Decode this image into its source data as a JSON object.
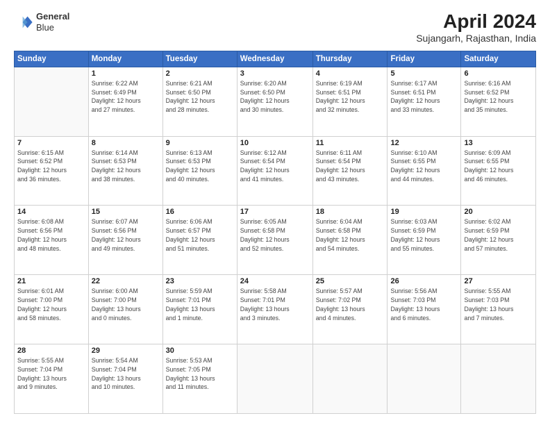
{
  "logo": {
    "line1": "General",
    "line2": "Blue"
  },
  "title": "April 2024",
  "subtitle": "Sujangarh, Rajasthan, India",
  "header": {
    "days": [
      "Sunday",
      "Monday",
      "Tuesday",
      "Wednesday",
      "Thursday",
      "Friday",
      "Saturday"
    ]
  },
  "weeks": [
    [
      {
        "day": "",
        "info": ""
      },
      {
        "day": "1",
        "info": "Sunrise: 6:22 AM\nSunset: 6:49 PM\nDaylight: 12 hours\nand 27 minutes."
      },
      {
        "day": "2",
        "info": "Sunrise: 6:21 AM\nSunset: 6:50 PM\nDaylight: 12 hours\nand 28 minutes."
      },
      {
        "day": "3",
        "info": "Sunrise: 6:20 AM\nSunset: 6:50 PM\nDaylight: 12 hours\nand 30 minutes."
      },
      {
        "day": "4",
        "info": "Sunrise: 6:19 AM\nSunset: 6:51 PM\nDaylight: 12 hours\nand 32 minutes."
      },
      {
        "day": "5",
        "info": "Sunrise: 6:17 AM\nSunset: 6:51 PM\nDaylight: 12 hours\nand 33 minutes."
      },
      {
        "day": "6",
        "info": "Sunrise: 6:16 AM\nSunset: 6:52 PM\nDaylight: 12 hours\nand 35 minutes."
      }
    ],
    [
      {
        "day": "7",
        "info": "Sunrise: 6:15 AM\nSunset: 6:52 PM\nDaylight: 12 hours\nand 36 minutes."
      },
      {
        "day": "8",
        "info": "Sunrise: 6:14 AM\nSunset: 6:53 PM\nDaylight: 12 hours\nand 38 minutes."
      },
      {
        "day": "9",
        "info": "Sunrise: 6:13 AM\nSunset: 6:53 PM\nDaylight: 12 hours\nand 40 minutes."
      },
      {
        "day": "10",
        "info": "Sunrise: 6:12 AM\nSunset: 6:54 PM\nDaylight: 12 hours\nand 41 minutes."
      },
      {
        "day": "11",
        "info": "Sunrise: 6:11 AM\nSunset: 6:54 PM\nDaylight: 12 hours\nand 43 minutes."
      },
      {
        "day": "12",
        "info": "Sunrise: 6:10 AM\nSunset: 6:55 PM\nDaylight: 12 hours\nand 44 minutes."
      },
      {
        "day": "13",
        "info": "Sunrise: 6:09 AM\nSunset: 6:55 PM\nDaylight: 12 hours\nand 46 minutes."
      }
    ],
    [
      {
        "day": "14",
        "info": "Sunrise: 6:08 AM\nSunset: 6:56 PM\nDaylight: 12 hours\nand 48 minutes."
      },
      {
        "day": "15",
        "info": "Sunrise: 6:07 AM\nSunset: 6:56 PM\nDaylight: 12 hours\nand 49 minutes."
      },
      {
        "day": "16",
        "info": "Sunrise: 6:06 AM\nSunset: 6:57 PM\nDaylight: 12 hours\nand 51 minutes."
      },
      {
        "day": "17",
        "info": "Sunrise: 6:05 AM\nSunset: 6:58 PM\nDaylight: 12 hours\nand 52 minutes."
      },
      {
        "day": "18",
        "info": "Sunrise: 6:04 AM\nSunset: 6:58 PM\nDaylight: 12 hours\nand 54 minutes."
      },
      {
        "day": "19",
        "info": "Sunrise: 6:03 AM\nSunset: 6:59 PM\nDaylight: 12 hours\nand 55 minutes."
      },
      {
        "day": "20",
        "info": "Sunrise: 6:02 AM\nSunset: 6:59 PM\nDaylight: 12 hours\nand 57 minutes."
      }
    ],
    [
      {
        "day": "21",
        "info": "Sunrise: 6:01 AM\nSunset: 7:00 PM\nDaylight: 12 hours\nand 58 minutes."
      },
      {
        "day": "22",
        "info": "Sunrise: 6:00 AM\nSunset: 7:00 PM\nDaylight: 13 hours\nand 0 minutes."
      },
      {
        "day": "23",
        "info": "Sunrise: 5:59 AM\nSunset: 7:01 PM\nDaylight: 13 hours\nand 1 minute."
      },
      {
        "day": "24",
        "info": "Sunrise: 5:58 AM\nSunset: 7:01 PM\nDaylight: 13 hours\nand 3 minutes."
      },
      {
        "day": "25",
        "info": "Sunrise: 5:57 AM\nSunset: 7:02 PM\nDaylight: 13 hours\nand 4 minutes."
      },
      {
        "day": "26",
        "info": "Sunrise: 5:56 AM\nSunset: 7:03 PM\nDaylight: 13 hours\nand 6 minutes."
      },
      {
        "day": "27",
        "info": "Sunrise: 5:55 AM\nSunset: 7:03 PM\nDaylight: 13 hours\nand 7 minutes."
      }
    ],
    [
      {
        "day": "28",
        "info": "Sunrise: 5:55 AM\nSunset: 7:04 PM\nDaylight: 13 hours\nand 9 minutes."
      },
      {
        "day": "29",
        "info": "Sunrise: 5:54 AM\nSunset: 7:04 PM\nDaylight: 13 hours\nand 10 minutes."
      },
      {
        "day": "30",
        "info": "Sunrise: 5:53 AM\nSunset: 7:05 PM\nDaylight: 13 hours\nand 11 minutes."
      },
      {
        "day": "",
        "info": ""
      },
      {
        "day": "",
        "info": ""
      },
      {
        "day": "",
        "info": ""
      },
      {
        "day": "",
        "info": ""
      }
    ]
  ]
}
